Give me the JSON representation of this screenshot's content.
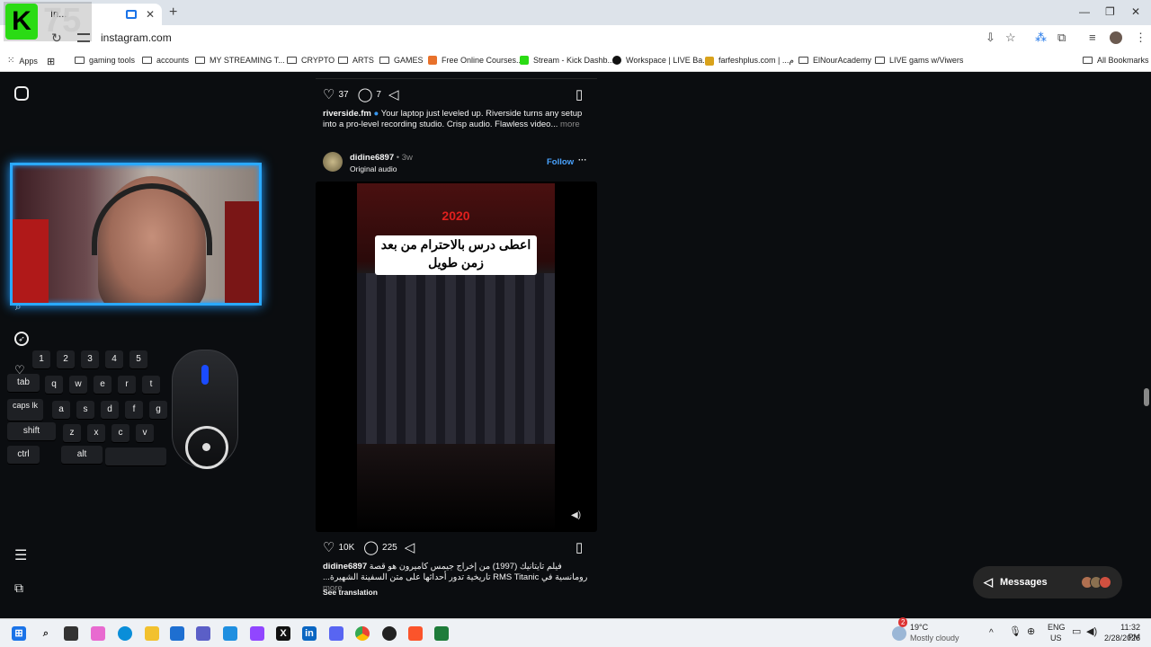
{
  "browser": {
    "tab_title": "In...",
    "url": "instagram.com",
    "bookmarks": [
      {
        "label": "Apps",
        "type": "apps"
      },
      {
        "label": "gaming tools",
        "type": "folder"
      },
      {
        "label": "accounts",
        "type": "folder"
      },
      {
        "label": "MY STREAMING T...",
        "type": "folder"
      },
      {
        "label": "CRYPTO",
        "type": "folder"
      },
      {
        "label": "ARTS",
        "type": "folder"
      },
      {
        "label": "GAMES",
        "type": "folder"
      },
      {
        "label": "Free Online Courses...",
        "type": "site",
        "color": "#e8712b"
      },
      {
        "label": "Stream - Kick Dashb...",
        "type": "site",
        "color": "#2bdb14"
      },
      {
        "label": "Workspace | LIVE Ba...",
        "type": "site",
        "color": "#111111"
      },
      {
        "label": "farfeshplus.com | ...م",
        "type": "site",
        "color": "#d9a21b"
      },
      {
        "label": "ElNourAcademy",
        "type": "folder"
      },
      {
        "label": "LIVE gams w/Viwers",
        "type": "folder"
      }
    ],
    "all_bookmarks": "All Bookmarks"
  },
  "overlay": {
    "logo_letter": "K",
    "logo_number": "75"
  },
  "keyboard": {
    "numbers": [
      "1",
      "2",
      "3",
      "4",
      "5"
    ],
    "row1": [
      "tab",
      "q",
      "w",
      "e",
      "r",
      "t"
    ],
    "row2": [
      "caps lk",
      "a",
      "s",
      "d",
      "f",
      "g"
    ],
    "row3": [
      "shift",
      "z",
      "x",
      "c",
      "v"
    ],
    "row4": [
      "ctrl",
      "alt"
    ]
  },
  "post1": {
    "likes": "37",
    "comments": "7",
    "username": "riverside.fm",
    "caption": "Your laptop just leveled up. Riverside turns any setup into a pro-level recording studio. Crisp audio. Flawless video...",
    "more": "more"
  },
  "post2": {
    "username": "didine6897",
    "time": "3w",
    "audio": "Original audio",
    "follow": "Follow",
    "video_year": "2020",
    "video_title": "اعطى درس بالاحترام من بعد زمن طويل",
    "likes": "10K",
    "comments": "225",
    "caption_user": "didine6897",
    "caption": "فيلم تايتانيك (1997) من إخراج جيمس كاميرون هو قصة رومانسية في RMS Titanic تاريخية تدور أحداثها على متن السفينة الشهيرة...",
    "more": "more",
    "see_translation": "See translation"
  },
  "messages": {
    "label": "Messages"
  },
  "taskbar": {
    "weather_temp": "19°C",
    "weather_desc": "Mostly cloudy",
    "weather_badge": "2",
    "lang1": "ENG",
    "lang2": "US",
    "time": "11:32 PM",
    "date": "2/28/2026"
  }
}
